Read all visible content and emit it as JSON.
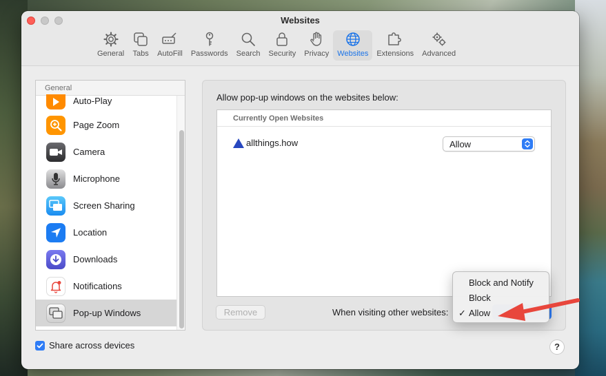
{
  "window": {
    "title": "Websites"
  },
  "tabs": [
    {
      "label": "General",
      "icon": "gear-icon"
    },
    {
      "label": "Tabs",
      "icon": "tabs-icon"
    },
    {
      "label": "AutoFill",
      "icon": "autofill-icon"
    },
    {
      "label": "Passwords",
      "icon": "key-icon"
    },
    {
      "label": "Search",
      "icon": "search-icon"
    },
    {
      "label": "Security",
      "icon": "lock-icon"
    },
    {
      "label": "Privacy",
      "icon": "hand-icon"
    },
    {
      "label": "Websites",
      "icon": "globe-icon",
      "active": true
    },
    {
      "label": "Extensions",
      "icon": "puzzle-icon"
    },
    {
      "label": "Advanced",
      "icon": "gears-icon"
    }
  ],
  "sidebar": {
    "header": "General",
    "items": [
      {
        "label": "Auto-Play",
        "icon": "play-icon",
        "color": "#ff8a00"
      },
      {
        "label": "Page Zoom",
        "icon": "zoom-icon",
        "color": "#ff9500"
      },
      {
        "label": "Camera",
        "icon": "camera-icon",
        "color": "#3a3a3c"
      },
      {
        "label": "Microphone",
        "icon": "microphone-icon",
        "color": "#5a5a5e"
      },
      {
        "label": "Screen Sharing",
        "icon": "screen-sharing-icon",
        "color": "#1aa3ff"
      },
      {
        "label": "Location",
        "icon": "location-icon",
        "color": "#1c7cf2"
      },
      {
        "label": "Downloads",
        "icon": "download-icon",
        "color": "#5b5bd6"
      },
      {
        "label": "Notifications",
        "icon": "bell-icon",
        "color": "#ffffff"
      },
      {
        "label": "Pop-up Windows",
        "icon": "popup-windows-icon",
        "color": "#ececec",
        "selected": true
      }
    ]
  },
  "main": {
    "label": "Allow pop-up windows on the websites below:",
    "table_header": "Currently Open Websites",
    "sites": [
      {
        "name": "allthings.how",
        "setting": "Allow"
      }
    ],
    "remove_label": "Remove",
    "other_label": "When visiting other websites:"
  },
  "dropdown": {
    "options": [
      "Block and Notify",
      "Block",
      "Allow"
    ],
    "selected": "Allow",
    "check": "✓"
  },
  "footer": {
    "share_label": "Share across devices",
    "share_checked": true,
    "help_label": "?"
  },
  "colors": {
    "accent": "#2e7cf6",
    "annotation_arrow": "#e8463c"
  }
}
